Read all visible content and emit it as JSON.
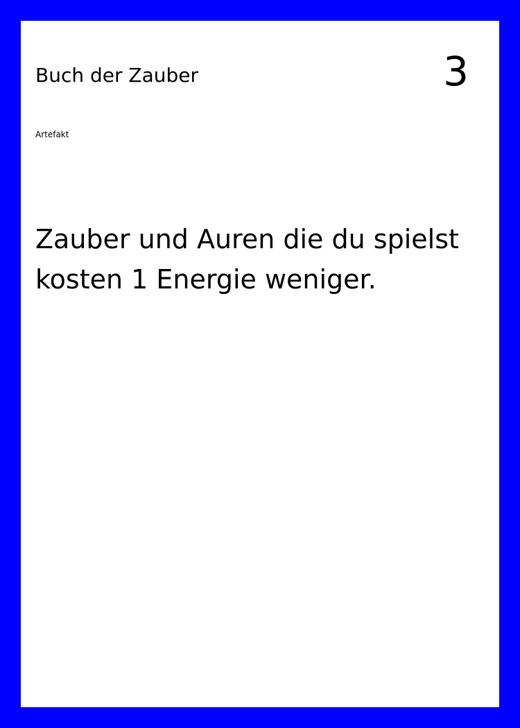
{
  "card": {
    "name": "Buch der Zauber",
    "cost": "3",
    "type": "Artefakt",
    "text_lines": [
      "Zauber und Auren die du spielst",
      "kosten 1 Energie weniger."
    ]
  },
  "colors": {
    "border": "#0000ff",
    "card_background": "#ffffff",
    "text": "#000000"
  }
}
